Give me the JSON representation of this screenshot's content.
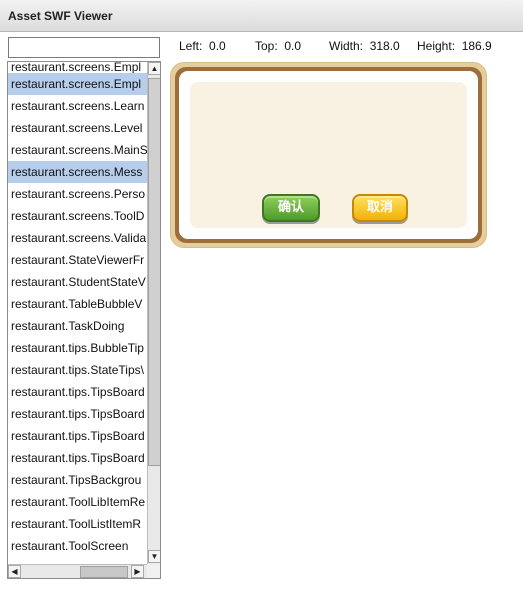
{
  "window": {
    "title": "Asset SWF Viewer"
  },
  "search": {
    "value": "",
    "placeholder": ""
  },
  "metrics": {
    "left_label": "Left:",
    "left_value": "0.0",
    "top_label": "Top:",
    "top_value": "0.0",
    "width_label": "Width:",
    "width_value": "318.0",
    "height_label": "Height:",
    "height_value": "186.9"
  },
  "list": {
    "items": [
      "restaurant.screens.Empl",
      "restaurant.screens.Empl",
      "restaurant.screens.Learn",
      "restaurant.screens.Level",
      "restaurant.screens.MainS",
      "restaurant.screens.Mess",
      "restaurant.screens.Perso",
      "restaurant.screens.ToolD",
      "restaurant.screens.Valida",
      "restaurant.StateViewerFr",
      "restaurant.StudentStateV",
      "restaurant.TableBubbleV",
      "restaurant.TaskDoing",
      "restaurant.tips.BubbleTip",
      "restaurant.tips.StateTips\\",
      "restaurant.tips.TipsBoard",
      "restaurant.tips.TipsBoard",
      "restaurant.tips.TipsBoard",
      "restaurant.tips.TipsBoard",
      "restaurant.TipsBackgrou",
      "restaurant.ToolLibItemRe",
      "restaurant.ToolListItemR",
      "restaurant.ToolScreen"
    ],
    "highlighted_item": "restaurant.screens.Empl",
    "selected_item": "restaurant.screens.Mess"
  },
  "preview": {
    "confirm_label": "确认",
    "cancel_label": "取消"
  },
  "scrollbar": {
    "up_arrow": "▲",
    "down_arrow": "▼",
    "left_arrow": "◀",
    "right_arrow": "▶"
  },
  "colors": {
    "selection": "#b6cdec",
    "panel_border": "#9e6e3a",
    "panel_fill": "#f9f1e2",
    "confirm_button": "#5fa836",
    "cancel_button": "#f2b20c"
  }
}
